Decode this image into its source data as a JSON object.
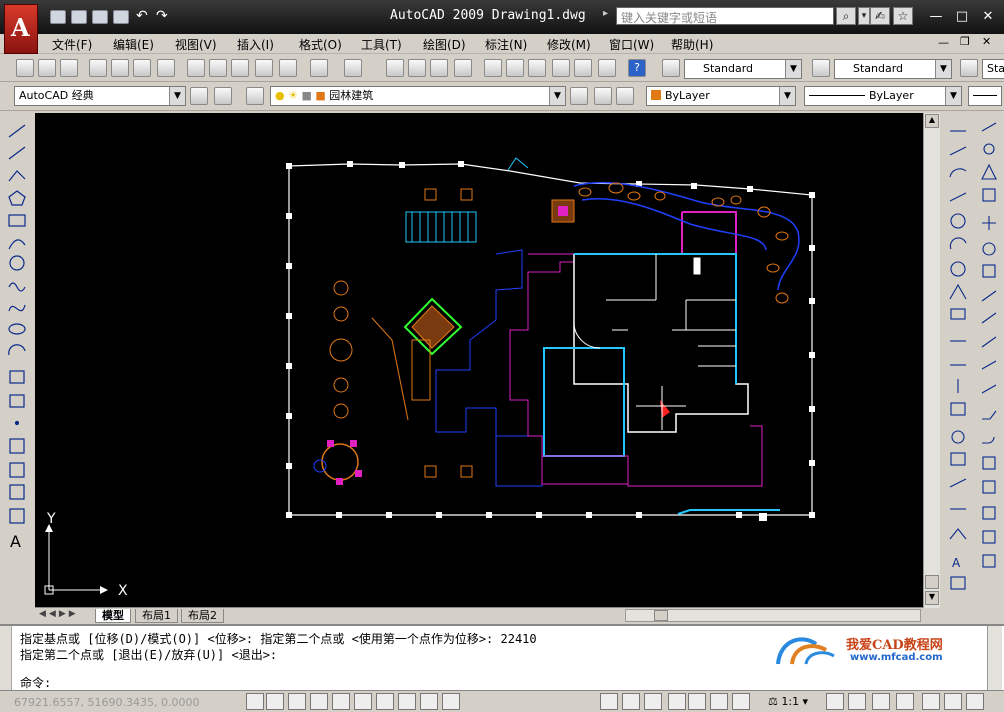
{
  "app": {
    "title": "AutoCAD 2009 Drawing1.dwg",
    "logo_letter": "A",
    "search_placeholder": "键入关键字或短语"
  },
  "menu": [
    "文件(F)",
    "编辑(E)",
    "视图(V)",
    "插入(I)",
    "格式(O)",
    "工具(T)",
    "绘图(D)",
    "标注(N)",
    "修改(M)",
    "窗口(W)",
    "帮助(H)"
  ],
  "toolbar": {
    "text_style": "Standard",
    "dim_style": "Standard",
    "table_style": "Sta"
  },
  "layers": {
    "workspace": "AutoCAD 经典",
    "current_layer": "园林建筑",
    "color": "ByLayer",
    "linetype": "ByLayer"
  },
  "ucs": {
    "y": "Y",
    "x": "X"
  },
  "layout_tabs": [
    "模型",
    "布局1",
    "布局2"
  ],
  "command": {
    "line1": "指定基点或 [位移(D)/模式(O)] <位移>: 指定第二个点或 <使用第一个点作为位移>: 22410",
    "line2": "指定第二个点或 [退出(E)/放弃(U)] <退出>:",
    "prompt": "命令:"
  },
  "status": {
    "coords": "67921.6557, 51690.3435, 0.0000",
    "scale": "1:1"
  },
  "brand": {
    "name": "我爱CAD教程网",
    "url": "www.mfcad.com"
  },
  "colors": {
    "canvas": "#000000",
    "white": "#ffffff",
    "cyan": "#22c8ff",
    "magenta": "#e020c0",
    "blue": "#2040ff",
    "orange": "#e07818",
    "green": "#30ff30",
    "red": "#ff2020"
  }
}
